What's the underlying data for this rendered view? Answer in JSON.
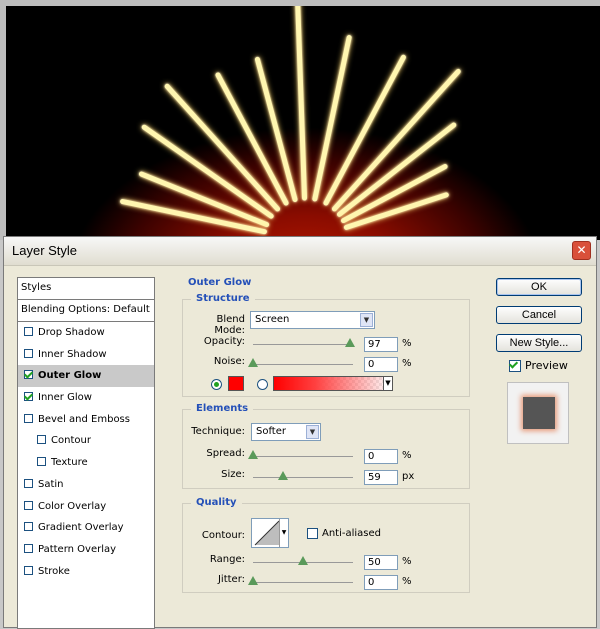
{
  "dialog": {
    "title": "Layer Style"
  },
  "styles_panel": {
    "header": "Styles",
    "blending_options": "Blending Options: Default",
    "items": [
      {
        "label": "Drop Shadow",
        "checked": false,
        "sub": false,
        "selected": false
      },
      {
        "label": "Inner Shadow",
        "checked": false,
        "sub": false,
        "selected": false
      },
      {
        "label": "Outer Glow",
        "checked": true,
        "sub": false,
        "selected": true
      },
      {
        "label": "Inner Glow",
        "checked": true,
        "sub": false,
        "selected": false
      },
      {
        "label": "Bevel and Emboss",
        "checked": false,
        "sub": false,
        "selected": false
      },
      {
        "label": "Contour",
        "checked": false,
        "sub": true,
        "selected": false
      },
      {
        "label": "Texture",
        "checked": false,
        "sub": true,
        "selected": false
      },
      {
        "label": "Satin",
        "checked": false,
        "sub": false,
        "selected": false
      },
      {
        "label": "Color Overlay",
        "checked": false,
        "sub": false,
        "selected": false
      },
      {
        "label": "Gradient Overlay",
        "checked": false,
        "sub": false,
        "selected": false
      },
      {
        "label": "Pattern Overlay",
        "checked": false,
        "sub": false,
        "selected": false
      },
      {
        "label": "Stroke",
        "checked": false,
        "sub": false,
        "selected": false
      }
    ]
  },
  "outer_glow": {
    "title": "Outer Glow",
    "structure": {
      "title": "Structure",
      "blend_mode_label": "Blend Mode:",
      "blend_mode": "Screen",
      "opacity_label": "Opacity:",
      "opacity": "97",
      "noise_label": "Noise:",
      "noise": "0",
      "percent": "%",
      "color": "#ff0000",
      "color_radio_selected": true
    },
    "elements": {
      "title": "Elements",
      "technique_label": "Technique:",
      "technique": "Softer",
      "spread_label": "Spread:",
      "spread": "0",
      "spread_unit": "%",
      "size_label": "Size:",
      "size": "59",
      "size_unit": "px"
    },
    "quality": {
      "title": "Quality",
      "contour_label": "Contour:",
      "anti_aliased_label": "Anti-aliased",
      "anti_aliased": false,
      "range_label": "Range:",
      "range": "50",
      "range_unit": "%",
      "jitter_label": "Jitter:",
      "jitter": "0",
      "jitter_unit": "%"
    }
  },
  "buttons": {
    "ok": "OK",
    "cancel": "Cancel",
    "new_style": "New Style..."
  },
  "preview": {
    "label": "Preview",
    "checked": true
  },
  "sliders": {
    "opacity": 0.97,
    "noise": 0.0,
    "spread": 0.0,
    "size": 0.3,
    "range": 0.5,
    "jitter": 0.0
  }
}
